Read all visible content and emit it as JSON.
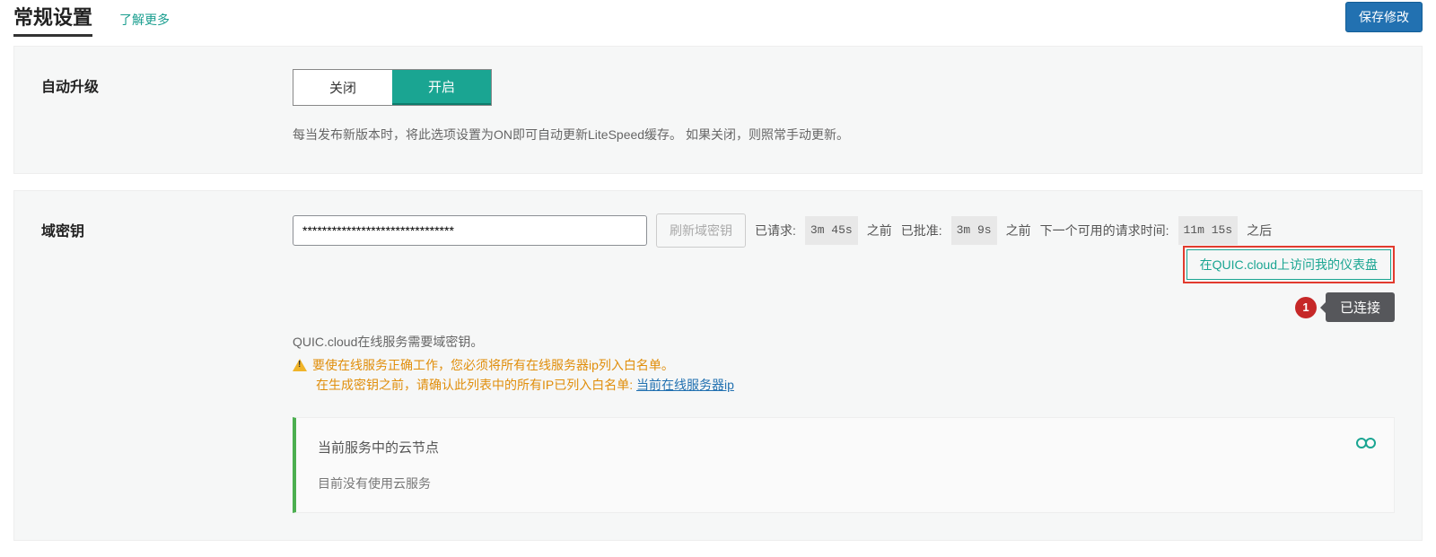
{
  "header": {
    "title": "常规设置",
    "learn_more": "了解更多",
    "save": "保存修改"
  },
  "auto_upgrade": {
    "label": "自动升级",
    "off": "关闭",
    "on": "开启",
    "desc": "每当发布新版本时，将此选项设置为ON即可自动更新LiteSpeed缓存。 如果关闭，则照常手动更新。"
  },
  "domain_key": {
    "label": "域密钥",
    "value": "*******************************",
    "refresh": "刷新域密钥",
    "requested_label": "已请求:",
    "requested_time": "3m 45s",
    "ago1": "之前",
    "approved_label": "已批准:",
    "approved_time": "3m 9s",
    "ago2": "之前",
    "next_label": "下一个可用的请求时间:",
    "next_time": "11m 15s",
    "after": "之后",
    "dash_link": "在QUIC.cloud上访问我的仪表盘",
    "connected": "已连接",
    "annot_num": "1",
    "info": "QUIC.cloud在线服务需要域密钥。",
    "warn1": "要使在线服务正确工作，您必须将所有在线服务器ip列入白名单。",
    "warn2": "在生成密钥之前，请确认此列表中的所有IP已列入白名单: ",
    "ip_link": "当前在线服务器ip"
  },
  "cloud_card": {
    "title": "当前服务中的云节点",
    "body": "目前没有使用云服务"
  }
}
